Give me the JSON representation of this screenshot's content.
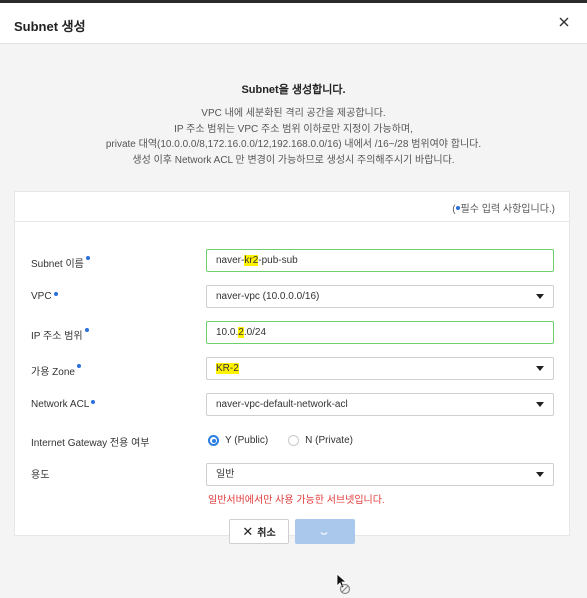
{
  "modal": {
    "title": "Subnet 생성",
    "close_icon": "close-icon"
  },
  "intro": {
    "title": "Subnet을 생성합니다.",
    "lines": [
      "VPC 내에 세분화된 격리 공간을 제공합니다.",
      "IP 주소 범위는 VPC 주소 범위 이하로만 지정이 가능하며,",
      "private 대역(10.0.0.0/8,172.16.0.0/12,192.168.0.0/16) 내에서 /16~/28 범위여야 합니다.",
      "생성 이후 Network ACL 만 변경이 가능하므로 생성시 주의해주시기 바랍니다."
    ]
  },
  "form": {
    "required_note_open": "(",
    "required_note_text": "필수 입력 사항입니다.)",
    "subnet_name": {
      "label": "Subnet 이름",
      "value_pre": "naver-",
      "value_hl": "kr2",
      "value_post": "-pub-sub"
    },
    "vpc": {
      "label": "VPC",
      "selected": "naver-vpc (10.0.0.0/16)"
    },
    "ip_range": {
      "label": "IP 주소 범위",
      "value_pre": "10.0.",
      "value_hl": "2",
      "value_post": ".0/24"
    },
    "zone": {
      "label": "가용 Zone",
      "selected": "KR-2"
    },
    "network_acl": {
      "label": "Network ACL",
      "selected": "naver-vpc-default-network-acl"
    },
    "internet_gateway": {
      "label": "Internet Gateway 전용 여부",
      "option_yes": "Y (Public)",
      "option_no": "N (Private)",
      "selected": "yes"
    },
    "usage": {
      "label": "용도",
      "selected": "일반",
      "note": "일반서버에서만 사용 가능한 서브넷입니다."
    }
  },
  "buttons": {
    "cancel_label": "취소",
    "create_state": "loading"
  },
  "colors": {
    "accent": "#2a7de1",
    "highlight": "#fff200",
    "error": "#e23b3b",
    "create_button": "#a9c8ec"
  }
}
